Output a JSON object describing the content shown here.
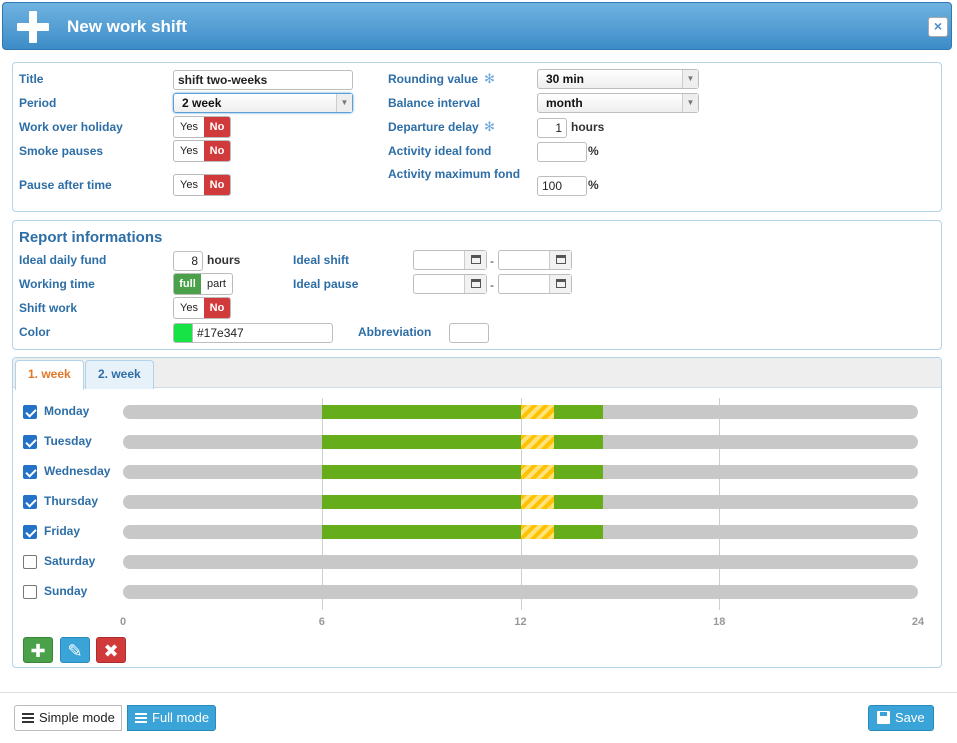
{
  "window": {
    "title": "New work shift",
    "close_label": "×"
  },
  "general": {
    "title_label": "Title",
    "title_value": "shift two-weeks",
    "period_label": "Period",
    "period_value": "2 week",
    "work_over_holiday_label": "Work over holiday",
    "smoke_pauses_label": "Smoke pauses",
    "pause_after_time_label": "Pause after time",
    "rounding_label": "Rounding value",
    "rounding_value": "30 min",
    "balance_label": "Balance interval",
    "balance_value": "month",
    "departure_label": "Departure delay",
    "departure_value": "1",
    "departure_unit": "hours",
    "ideal_fond_label": "Activity ideal fond",
    "ideal_fond_value": "",
    "ideal_fond_unit": "%",
    "max_fond_label": "Activity maximum fond",
    "max_fond_value": "100",
    "max_fond_unit": "%"
  },
  "toggles": {
    "yes": "Yes",
    "no": "No",
    "full": "full",
    "part": "part"
  },
  "report": {
    "section_title": "Report informations",
    "ideal_daily_fund_label": "Ideal daily fund",
    "ideal_daily_fund_value": "8",
    "ideal_daily_fund_unit": "hours",
    "working_time_label": "Working time",
    "shift_work_label": "Shift work",
    "color_label": "Color",
    "color_value": "#17e347",
    "ideal_shift_label": "Ideal shift",
    "ideal_pause_label": "Ideal pause",
    "range_separator": "-",
    "abbreviation_label": "Abbreviation",
    "abbreviation_value": ""
  },
  "tabs": [
    {
      "label": "1. week",
      "active": true
    },
    {
      "label": "2. week",
      "active": false
    }
  ],
  "schedule": {
    "axis_ticks": [
      "0",
      "6",
      "12",
      "18",
      "24"
    ],
    "axis_range": [
      0,
      24
    ],
    "days": [
      {
        "name": "Monday",
        "checked": true,
        "segments": [
          {
            "type": "work",
            "start": 6,
            "end": 12
          },
          {
            "type": "pause",
            "start": 12,
            "end": 13
          },
          {
            "type": "work",
            "start": 13,
            "end": 14.5
          }
        ]
      },
      {
        "name": "Tuesday",
        "checked": true,
        "segments": [
          {
            "type": "work",
            "start": 6,
            "end": 12
          },
          {
            "type": "pause",
            "start": 12,
            "end": 13
          },
          {
            "type": "work",
            "start": 13,
            "end": 14.5
          }
        ]
      },
      {
        "name": "Wednesday",
        "checked": true,
        "segments": [
          {
            "type": "work",
            "start": 6,
            "end": 12
          },
          {
            "type": "pause",
            "start": 12,
            "end": 13
          },
          {
            "type": "work",
            "start": 13,
            "end": 14.5
          }
        ]
      },
      {
        "name": "Thursday",
        "checked": true,
        "segments": [
          {
            "type": "work",
            "start": 6,
            "end": 12
          },
          {
            "type": "pause",
            "start": 12,
            "end": 13
          },
          {
            "type": "work",
            "start": 13,
            "end": 14.5
          }
        ]
      },
      {
        "name": "Friday",
        "checked": true,
        "segments": [
          {
            "type": "work",
            "start": 6,
            "end": 12
          },
          {
            "type": "pause",
            "start": 12,
            "end": 13
          },
          {
            "type": "work",
            "start": 13,
            "end": 14.5
          }
        ]
      },
      {
        "name": "Saturday",
        "checked": false,
        "segments": []
      },
      {
        "name": "Sunday",
        "checked": false,
        "segments": []
      }
    ]
  },
  "footer": {
    "simple_mode": "Simple mode",
    "full_mode": "Full mode",
    "save": "Save"
  },
  "colors": {
    "work": "#65ad1a",
    "pause": "#ffc200",
    "track": "#c8c8c8",
    "accent": "#3aa3d8",
    "danger": "#d13a3a"
  }
}
